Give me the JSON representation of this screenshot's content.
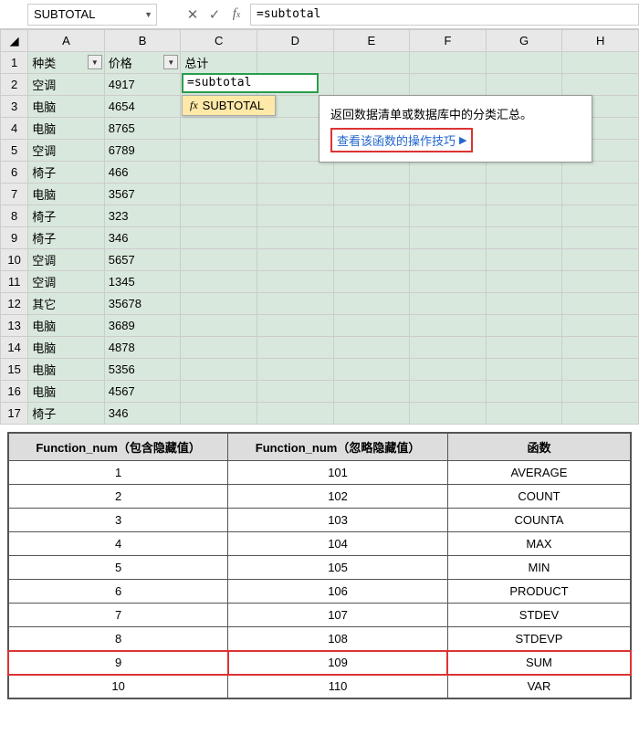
{
  "formula_bar": {
    "name_box": "SUBTOTAL",
    "formula": "=subtotal"
  },
  "columns": [
    "A",
    "B",
    "C",
    "D",
    "E",
    "F",
    "G",
    "H"
  ],
  "header_row": {
    "A": "种类",
    "B": "价格",
    "C": "总计"
  },
  "rows": [
    {
      "num": 1,
      "A": "种类",
      "B": "价格",
      "C": "总计"
    },
    {
      "num": 2,
      "A": "空调",
      "B": "4917",
      "C": "=subtotal"
    },
    {
      "num": 3,
      "A": "电脑",
      "B": "4654",
      "C": ""
    },
    {
      "num": 4,
      "A": "电脑",
      "B": "8765",
      "C": ""
    },
    {
      "num": 5,
      "A": "空调",
      "B": "6789",
      "C": ""
    },
    {
      "num": 6,
      "A": "椅子",
      "B": "466",
      "C": ""
    },
    {
      "num": 7,
      "A": "电脑",
      "B": "3567",
      "C": ""
    },
    {
      "num": 8,
      "A": "椅子",
      "B": "323",
      "C": ""
    },
    {
      "num": 9,
      "A": "椅子",
      "B": "346",
      "C": ""
    },
    {
      "num": 10,
      "A": "空调",
      "B": "5657",
      "C": ""
    },
    {
      "num": 11,
      "A": "空调",
      "B": "1345",
      "C": ""
    },
    {
      "num": 12,
      "A": "其它",
      "B": "35678",
      "C": ""
    },
    {
      "num": 13,
      "A": "电脑",
      "B": "3689",
      "C": ""
    },
    {
      "num": 14,
      "A": "电脑",
      "B": "4878",
      "C": ""
    },
    {
      "num": 15,
      "A": "电脑",
      "B": "5356",
      "C": ""
    },
    {
      "num": 16,
      "A": "电脑",
      "B": "4567",
      "C": ""
    },
    {
      "num": 17,
      "A": "椅子",
      "B": "346",
      "C": ""
    }
  ],
  "intellisense": {
    "item": "SUBTOTAL"
  },
  "tooltip": {
    "desc": "返回数据清单或数据库中的分类汇总。",
    "link": "查看该函数的操作技巧"
  },
  "ref_table": {
    "headers": [
      "Function_num（包含隐藏值）",
      "Function_num（忽略隐藏值）",
      "函数"
    ],
    "rows": [
      {
        "a": "1",
        "b": "101",
        "c": "AVERAGE",
        "hl": false
      },
      {
        "a": "2",
        "b": "102",
        "c": "COUNT",
        "hl": false
      },
      {
        "a": "3",
        "b": "103",
        "c": "COUNTA",
        "hl": false
      },
      {
        "a": "4",
        "b": "104",
        "c": "MAX",
        "hl": false
      },
      {
        "a": "5",
        "b": "105",
        "c": "MIN",
        "hl": false
      },
      {
        "a": "6",
        "b": "106",
        "c": "PRODUCT",
        "hl": false
      },
      {
        "a": "7",
        "b": "107",
        "c": "STDEV",
        "hl": false
      },
      {
        "a": "8",
        "b": "108",
        "c": "STDEVP",
        "hl": false
      },
      {
        "a": "9",
        "b": "109",
        "c": "SUM",
        "hl": true
      },
      {
        "a": "10",
        "b": "110",
        "c": "VAR",
        "hl": false
      }
    ]
  }
}
